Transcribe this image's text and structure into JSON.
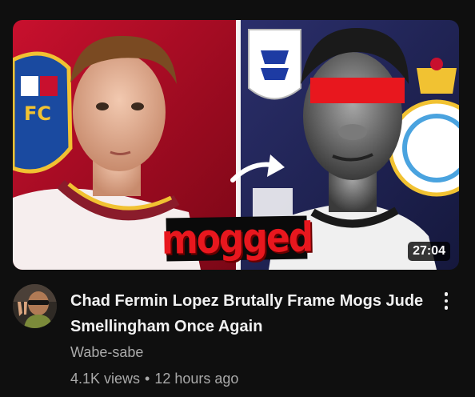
{
  "video": {
    "title": "Chad Fermin Lopez Brutally Frame Mogs Jude Smellingham Once Again",
    "channel": "Wabe-sabe",
    "views": "4.1K views",
    "separator": "•",
    "age": "12 hours ago",
    "duration": "27:04",
    "thumbnail_text": "mogged"
  },
  "icons": {
    "menu": "more-vertical-icon",
    "avatar": "channel-avatar"
  },
  "colors": {
    "background": "#0f0f0f",
    "title": "#f1f1f1",
    "secondary": "#aaaaaa",
    "overlay_red": "#e8171e",
    "censor_bar": "#e8171e"
  }
}
